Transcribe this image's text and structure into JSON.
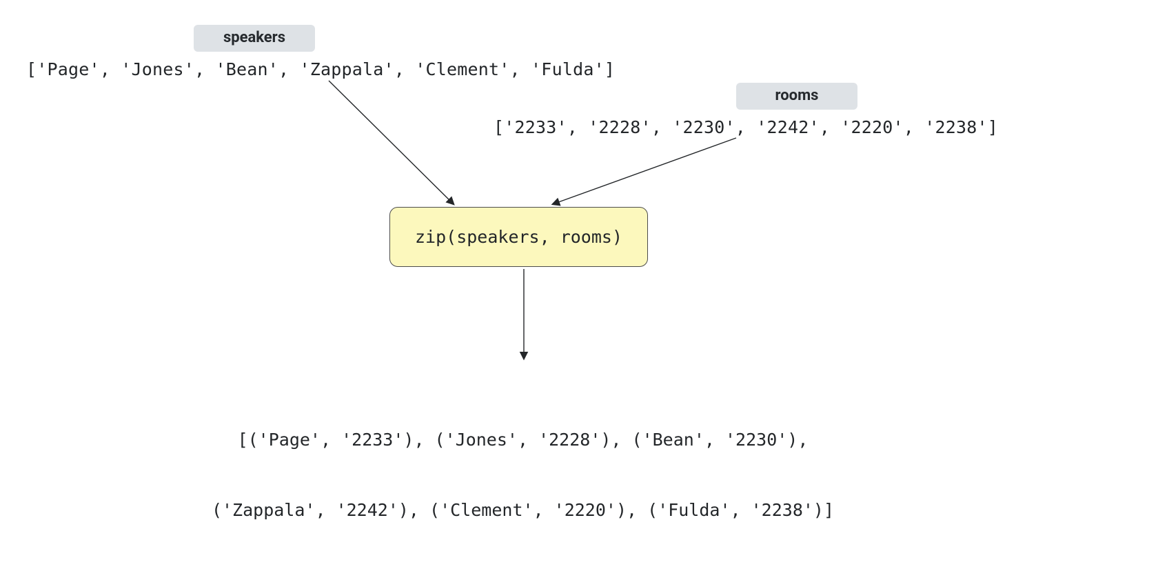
{
  "labels": {
    "speakers_chip": "speakers",
    "rooms_chip": "rooms"
  },
  "lists": {
    "speakers_code": "['Page', 'Jones', 'Bean', 'Zappala', 'Clement', 'Fulda']",
    "rooms_code": "['2233', '2228', '2230', '2242', '2220', '2238']"
  },
  "zip": {
    "call": "zip(speakers, rooms)"
  },
  "result": {
    "line1": "[('Page', '2233'), ('Jones', '2228'), ('Bean', '2230'),",
    "line2": "('Zappala', '2242'), ('Clement', '2220'), ('Fulda', '2238')]"
  },
  "chart_data": {
    "type": "diagram",
    "inputs": {
      "speakers": [
        "Page",
        "Jones",
        "Bean",
        "Zappala",
        "Clement",
        "Fulda"
      ],
      "rooms": [
        "2233",
        "2228",
        "2230",
        "2242",
        "2220",
        "2238"
      ]
    },
    "operation": "zip(speakers, rooms)",
    "output": [
      [
        "Page",
        "2233"
      ],
      [
        "Jones",
        "2228"
      ],
      [
        "Bean",
        "2230"
      ],
      [
        "Zappala",
        "2242"
      ],
      [
        "Clement",
        "2220"
      ],
      [
        "Fulda",
        "2238"
      ]
    ]
  }
}
